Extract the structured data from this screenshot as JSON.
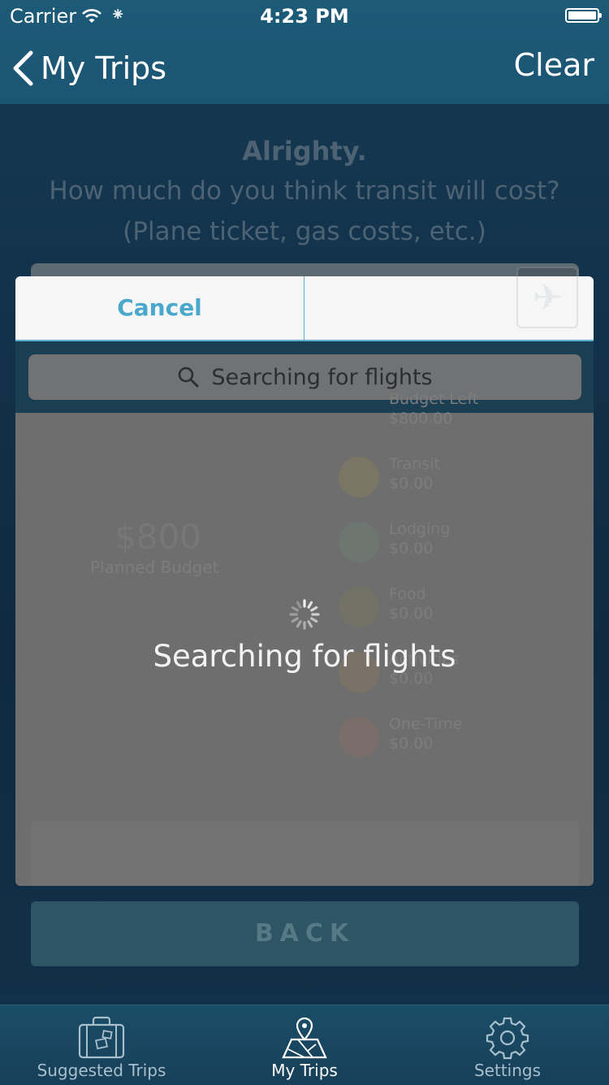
{
  "status": {
    "carrier": "Carrier",
    "time": "4:23 PM"
  },
  "navbar": {
    "back_label": "My Trips",
    "clear_label": "Clear"
  },
  "question": {
    "line1": "Alrighty.",
    "line2": "How much do you think transit will cost?",
    "line3": "(Plane ticket, gas costs, etc.)"
  },
  "modal": {
    "cancel_label": "Cancel",
    "search_placeholder": "Searching for flights",
    "loading_text": "Searching for flights",
    "budget_amount": "$800",
    "budget_caption": "Planned Budget",
    "categories": [
      {
        "name": "Budget Left",
        "amount": "$800.00"
      },
      {
        "name": "Transit",
        "amount": "$0.00"
      },
      {
        "name": "Lodging",
        "amount": "$0.00"
      },
      {
        "name": "Food",
        "amount": "$0.00"
      },
      {
        "name": "Activities",
        "amount": "$0.00"
      },
      {
        "name": "One-Time",
        "amount": "$0.00"
      }
    ]
  },
  "back_button": "BACK",
  "tabs": [
    {
      "label": "Suggested Trips",
      "icon": "suitcase-icon",
      "active": false
    },
    {
      "label": "My Trips",
      "icon": "map-pin-icon",
      "active": true
    },
    {
      "label": "Settings",
      "icon": "gear-icon",
      "active": false
    }
  ],
  "colors": {
    "accent": "#4aa8cc",
    "navbar": "#1d5a78",
    "tab_active": "#ffffff",
    "tab_inactive": "#a8bfcc"
  }
}
